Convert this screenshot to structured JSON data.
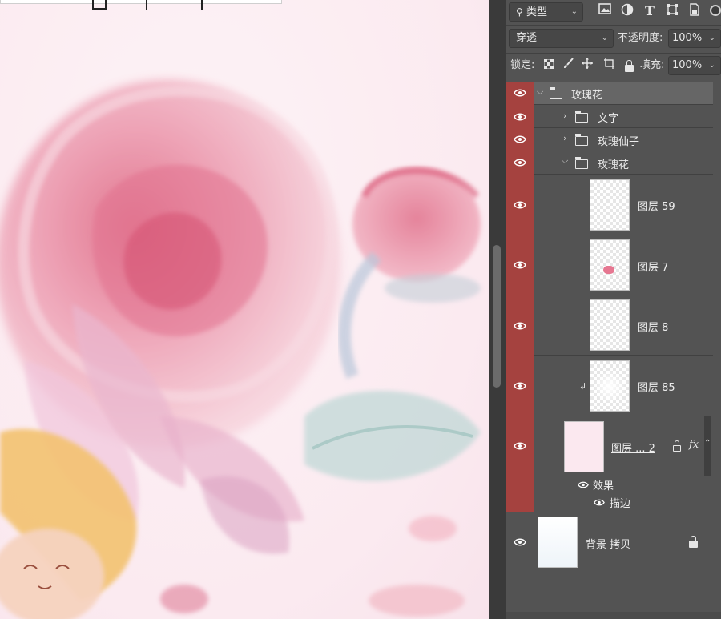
{
  "toolbar": {
    "filter_kind": "类型",
    "blend_mode": "穿透",
    "opacity_label": "不透明度:",
    "opacity_value": "100%",
    "lock_label": "锁定:",
    "fill_label": "填充:",
    "fill_value": "100%"
  },
  "layers": {
    "group_root": "玫瑰花",
    "group_text": "文字",
    "group_fairy": "玫瑰仙子",
    "group_rose": "玫瑰花",
    "layer_59": "图层 59",
    "layer_7": "图层 7",
    "layer_8": "图层 8",
    "layer_85": "图层 85",
    "layer_2": "图层 ... 2",
    "fx_label": "fx",
    "effects_label": "效果",
    "stroke_label": "描边",
    "background_copy": "背景 拷贝"
  },
  "colors": {
    "panel_bg": "#535353",
    "eye_column_red": "#a5423f",
    "selected_group": "#666666",
    "canvas_bg": "#fbeef3"
  },
  "icons": [
    "search-icon",
    "image-filter-icon",
    "adjustment-filter-icon",
    "text-filter-icon",
    "shape-filter-icon",
    "smartobject-filter-icon",
    "eye-icon",
    "folder-icon",
    "lock-icon",
    "clip-arrow-icon"
  ]
}
